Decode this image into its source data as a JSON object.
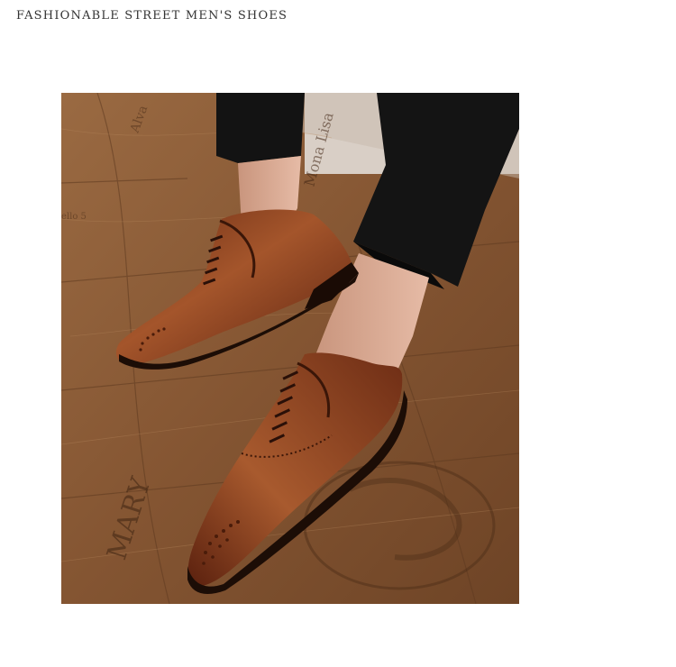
{
  "page": {
    "title": "FASHIONABLE STREET MEN'S SHOES"
  },
  "photo": {
    "subject": "brown brogue oxford shoes",
    "floor_text_1": "Mona Lisa",
    "floor_text_2": "MARY",
    "floor_text_3": "Alva",
    "floor_text_4": "ello 5"
  },
  "colors": {
    "floor": "#8a5a36",
    "leather": "#8b4223",
    "trousers": "#121212"
  }
}
